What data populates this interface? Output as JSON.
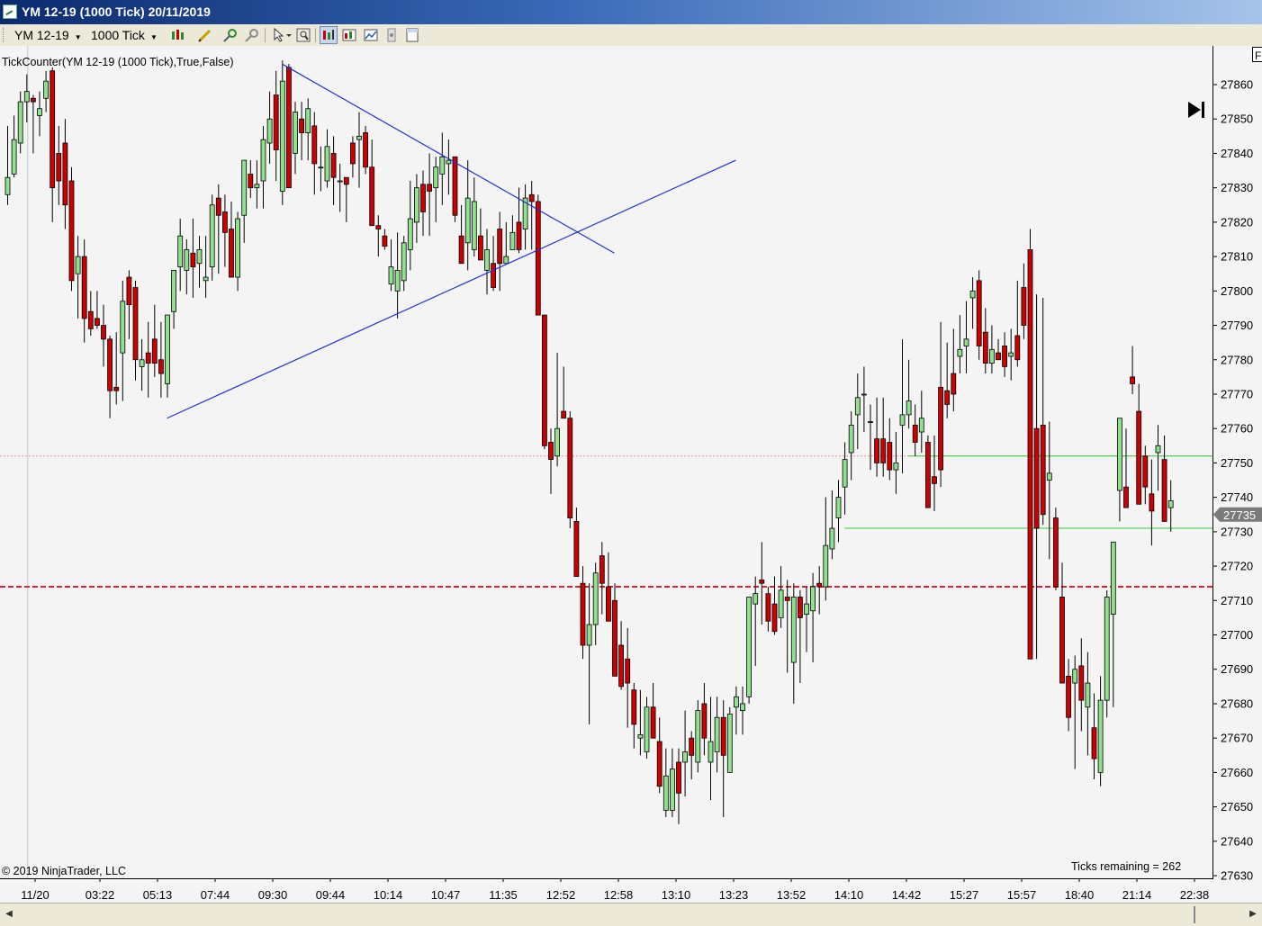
{
  "window": {
    "title": "YM 12-19 (1000 Tick)  20/11/2019",
    "icon": "chart-app-icon"
  },
  "toolbar": {
    "instrument": "YM 12-19",
    "interval": "1000 Tick",
    "icons": [
      "bar-style-icon",
      "pencil-draw-icon",
      "zoom-in-icon",
      "zoom-out-icon",
      "cursor-icon",
      "magnifier-icon",
      "data-series-icon",
      "indicators-icon",
      "strategies-icon",
      "properties-icon",
      "chart-trader-icon"
    ]
  },
  "chart": {
    "indicator_label": "TickCounter(YM 12-19 (1000 Tick),True,False)",
    "copyright": "© 2019 NinjaTrader, LLC",
    "ticks_remaining": "Ticks remaining = 262",
    "current_price_label": "27735",
    "corner_label": "F",
    "colors": {
      "up": "#90e090",
      "down": "#cc0000",
      "trendline": "#2233cc",
      "hline_green": "#33cc33",
      "hline_red": "#dd2233",
      "hline_dotted": "#e89090"
    }
  },
  "chart_data": {
    "type": "candlestick",
    "y_axis": {
      "ticks": [
        "27860",
        "27850",
        "27840",
        "27830",
        "27820",
        "27810",
        "27800",
        "27790",
        "27780",
        "27770",
        "27760",
        "27750",
        "27740",
        "27730",
        "27720",
        "27710",
        "27700",
        "27690",
        "27680",
        "27670",
        "27660",
        "27650",
        "27640",
        "27630"
      ],
      "range": [
        27628,
        27866
      ]
    },
    "x_axis": {
      "ticks": [
        "11/20",
        "03:22",
        "05:13",
        "07:44",
        "09:30",
        "09:44",
        "10:14",
        "10:47",
        "11:35",
        "12:52",
        "12:58",
        "13:10",
        "13:23",
        "13:52",
        "14:10",
        "14:42",
        "15:27",
        "15:57",
        "18:40",
        "21:14",
        "22:38"
      ]
    },
    "candles": [
      [
        27828,
        27848,
        27825,
        27833
      ],
      [
        27834,
        27851,
        27833,
        27844
      ],
      [
        27843,
        27858,
        27840,
        27855
      ],
      [
        27855,
        27863,
        27849,
        27858
      ],
      [
        27856,
        27857,
        27840,
        27855
      ],
      [
        27851,
        27858,
        27845,
        27853
      ],
      [
        27856,
        27864,
        27852,
        27861
      ],
      [
        27864,
        27865,
        27820,
        27830
      ],
      [
        27840,
        27848,
        27825,
        27832
      ],
      [
        27843,
        27850,
        27818,
        27825
      ],
      [
        27832,
        27836,
        27800,
        27803
      ],
      [
        27805,
        27816,
        27792,
        27810
      ],
      [
        27810,
        27815,
        27785,
        27792
      ],
      [
        27794,
        27800,
        27787,
        27789
      ],
      [
        27792,
        27800,
        27789,
        27790
      ],
      [
        27790,
        27796,
        27778,
        27786
      ],
      [
        27786,
        27787,
        27763,
        27771
      ],
      [
        27772,
        27788,
        27767,
        27771
      ],
      [
        27782,
        27803,
        27768,
        27797
      ],
      [
        27804,
        27806,
        27786,
        27796
      ],
      [
        27801,
        27803,
        27774,
        27780
      ],
      [
        27778,
        27786,
        27771,
        27780
      ],
      [
        27782,
        27791,
        27769,
        27779
      ],
      [
        27786,
        27796,
        27775,
        27779
      ],
      [
        27780,
        27791,
        27769,
        27776
      ],
      [
        27773,
        27791,
        27769,
        27793
      ],
      [
        27794,
        27805,
        27789,
        27806
      ],
      [
        27807,
        27821,
        27800,
        27816
      ],
      [
        27806,
        27815,
        27799,
        27812
      ],
      [
        27811,
        27821,
        27798,
        27807
      ],
      [
        27808,
        27816,
        27801,
        27812
      ],
      [
        27803,
        27816,
        27798,
        27804
      ],
      [
        27807,
        27828,
        27803,
        27825
      ],
      [
        27827,
        27831,
        27805,
        27822
      ],
      [
        27823,
        27828,
        27807,
        27817
      ],
      [
        27818,
        27826,
        27806,
        27804
      ],
      [
        27804,
        27823,
        27800,
        27821
      ],
      [
        27822,
        27837,
        27814,
        27838
      ],
      [
        27834,
        27838,
        27827,
        27830
      ],
      [
        27830,
        27838,
        27824,
        27831
      ],
      [
        27832,
        27848,
        27824,
        27844
      ],
      [
        27843,
        27858,
        27837,
        27850
      ],
      [
        27857,
        27864,
        27832,
        27841
      ],
      [
        27829,
        27867,
        27825,
        27861
      ],
      [
        27865,
        27866,
        27840,
        27830
      ],
      [
        27840,
        27855,
        27834,
        27852
      ],
      [
        27850,
        27855,
        27838,
        27846
      ],
      [
        27846,
        27856,
        27838,
        27853
      ],
      [
        27848,
        27852,
        27828,
        27837
      ],
      [
        27836,
        27842,
        27829,
        27836
      ],
      [
        27832,
        27847,
        27830,
        27842
      ],
      [
        27840,
        27845,
        27825,
        27833
      ],
      [
        27832,
        27837,
        27823,
        27832
      ],
      [
        27833,
        27832,
        27820,
        27831
      ],
      [
        27843,
        27845,
        27833,
        27837
      ],
      [
        27844,
        27852,
        27830,
        27845
      ],
      [
        27846,
        27848,
        27834,
        27836
      ],
      [
        27836,
        27844,
        27826,
        27819
      ],
      [
        27819,
        27822,
        27810,
        27818
      ],
      [
        27816,
        27818,
        27812,
        27813
      ],
      [
        27802,
        27815,
        27800,
        27807
      ],
      [
        27800,
        27817,
        27792,
        27806
      ],
      [
        27803,
        27816,
        27800,
        27814
      ],
      [
        27812,
        27832,
        27806,
        27821
      ],
      [
        27820,
        27834,
        27814,
        27830
      ],
      [
        27831,
        27835,
        27816,
        27823
      ],
      [
        27831,
        27840,
        27816,
        27829
      ],
      [
        27830,
        27839,
        27820,
        27836
      ],
      [
        27834,
        27846,
        27825,
        27839
      ],
      [
        27837,
        27844,
        27828,
        27838
      ],
      [
        27839,
        27839,
        27820,
        27822
      ],
      [
        27816,
        27825,
        27808,
        27808
      ],
      [
        27814,
        27838,
        27806,
        27827
      ],
      [
        27812,
        27833,
        27810,
        27826
      ],
      [
        27816,
        27824,
        27809,
        27809
      ],
      [
        27806,
        27818,
        27799,
        27812
      ],
      [
        27808,
        27816,
        27800,
        27801
      ],
      [
        27818,
        27823,
        27800,
        27808
      ],
      [
        27808,
        27820,
        27809,
        27810
      ],
      [
        27812,
        27822,
        27812,
        27817
      ],
      [
        27820,
        27830,
        27811,
        27812
      ],
      [
        27818,
        27831,
        27812,
        27827
      ],
      [
        27828,
        27832,
        27812,
        27826
      ],
      [
        27826,
        27828,
        27796,
        27793
      ],
      [
        27793,
        27791,
        27754,
        27755
      ],
      [
        27756,
        27760,
        27741,
        27751
      ],
      [
        27752,
        27782,
        27749,
        27760
      ],
      [
        27765,
        27778,
        27763,
        27763
      ],
      [
        27763,
        27765,
        27731,
        27734
      ],
      [
        27733,
        27737,
        27719,
        27717
      ],
      [
        27715,
        27720,
        27693,
        27697
      ],
      [
        27697,
        27715,
        27674,
        27703
      ],
      [
        27703,
        27721,
        27697,
        27718
      ],
      [
        27723,
        27727,
        27706,
        27715
      ],
      [
        27714,
        27724,
        27709,
        27704
      ],
      [
        27710,
        27715,
        27690,
        27688
      ],
      [
        27697,
        27704,
        27684,
        27685
      ],
      [
        27693,
        27702,
        27673,
        27686
      ],
      [
        27684,
        27686,
        27667,
        27674
      ],
      [
        27670,
        27684,
        27665,
        27671
      ],
      [
        27666,
        27682,
        27664,
        27679
      ],
      [
        27679,
        27686,
        27670,
        27670
      ],
      [
        27669,
        27676,
        27654,
        27656
      ],
      [
        27649,
        27667,
        27647,
        27659
      ],
      [
        27649,
        27667,
        27647,
        27661
      ],
      [
        27663,
        27667,
        27645,
        27654
      ],
      [
        27663,
        27678,
        27653,
        27666
      ],
      [
        27670,
        27672,
        27658,
        27665
      ],
      [
        27663,
        27681,
        27660,
        27678
      ],
      [
        27680,
        27686,
        27665,
        27670
      ],
      [
        27663,
        27682,
        27652,
        27669
      ],
      [
        27666,
        27682,
        27660,
        27676
      ],
      [
        27676,
        27681,
        27647,
        27665
      ],
      [
        27660,
        27679,
        27660,
        27677
      ],
      [
        27679,
        27685,
        27671,
        27682
      ],
      [
        27678,
        27685,
        27671,
        27680
      ],
      [
        27682,
        27710,
        27680,
        27711
      ],
      [
        27709,
        27717,
        27691,
        27712
      ],
      [
        27716,
        27727,
        27703,
        27715
      ],
      [
        27712,
        27714,
        27701,
        27704
      ],
      [
        27709,
        27717,
        27700,
        27701
      ],
      [
        27705,
        27720,
        27702,
        27713
      ],
      [
        27711,
        27716,
        27689,
        27710
      ],
      [
        27692,
        27715,
        27680,
        27711
      ],
      [
        27711,
        27713,
        27686,
        27705
      ],
      [
        27706,
        27714,
        27695,
        27709
      ],
      [
        27707,
        27718,
        27692,
        27714
      ],
      [
        27715,
        27720,
        27706,
        27714
      ],
      [
        27714,
        27740,
        27710,
        27726
      ],
      [
        27725,
        27742,
        27722,
        27731
      ],
      [
        27734,
        27745,
        27727,
        27740
      ],
      [
        27743,
        27756,
        27735,
        27751
      ],
      [
        27753,
        27765,
        27745,
        27761
      ],
      [
        27764,
        27776,
        27754,
        27769
      ],
      [
        27770,
        27778,
        27759,
        27770
      ],
      [
        27762,
        27767,
        27748,
        27762
      ],
      [
        27757,
        27769,
        27746,
        27750
      ],
      [
        27757,
        27769,
        27746,
        27750
      ],
      [
        27756,
        27763,
        27745,
        27748
      ],
      [
        27748,
        27759,
        27741,
        27750
      ],
      [
        27761,
        27786,
        27747,
        27764
      ],
      [
        27764,
        27780,
        27760,
        27768
      ],
      [
        27761,
        27767,
        27752,
        27756
      ],
      [
        27759,
        27771,
        27753,
        27763
      ],
      [
        27756,
        27758,
        27739,
        27737
      ],
      [
        27746,
        27758,
        27736,
        27744
      ],
      [
        27772,
        27791,
        27743,
        27748
      ],
      [
        27771,
        27785,
        27763,
        27767
      ],
      [
        27776,
        27789,
        27765,
        27770
      ],
      [
        27781,
        27793,
        27776,
        27783
      ],
      [
        27784,
        27797,
        27776,
        27786
      ],
      [
        27798,
        27804,
        27789,
        27800
      ],
      [
        27803,
        27806,
        27780,
        27784
      ],
      [
        27788,
        27795,
        27776,
        27779
      ],
      [
        27779,
        27790,
        27776,
        27783
      ],
      [
        27782,
        27786,
        27780,
        27780
      ],
      [
        27784,
        27788,
        27775,
        27778
      ],
      [
        27781,
        27789,
        27774,
        27782
      ],
      [
        27787,
        27803,
        27778,
        27780
      ],
      [
        27801,
        27808,
        27786,
        27790
      ],
      [
        27812,
        27818,
        27696,
        27693
      ],
      [
        27760,
        27799,
        27693,
        27731
      ],
      [
        27761,
        27798,
        27732,
        27735
      ],
      [
        27745,
        27762,
        27722,
        27747
      ],
      [
        27734,
        27737,
        27713,
        27714
      ],
      [
        27711,
        27721,
        27699,
        27686
      ],
      [
        27688,
        27693,
        27672,
        27676
      ],
      [
        27686,
        27694,
        27661,
        27690
      ],
      [
        27691,
        27699,
        27672,
        27681
      ],
      [
        27679,
        27695,
        27665,
        27686
      ],
      [
        27673,
        27683,
        27658,
        27664
      ],
      [
        27660,
        27688,
        27656,
        27681
      ],
      [
        27681,
        27713,
        27676,
        27711
      ],
      [
        27706,
        27713,
        27679,
        27727
      ],
      [
        27742,
        27763,
        27733,
        27763
      ],
      [
        27743,
        27760,
        27738,
        27737
      ],
      [
        27775,
        27784,
        27770,
        27773
      ],
      [
        27765,
        27773,
        27750,
        27738
      ],
      [
        27752,
        27755,
        27738,
        27743
      ],
      [
        27741,
        27751,
        27726,
        27736
      ],
      [
        27753,
        27761,
        27742,
        27755
      ],
      [
        27751,
        27758,
        27733,
        27733
      ],
      [
        27737,
        27745,
        27730,
        27739
      ]
    ],
    "annotations": {
      "trendlines": [
        {
          "from": [
            43,
            27866
          ],
          "to": [
            95,
            27811
          ]
        },
        {
          "from": [
            25,
            27763
          ],
          "to": [
            114,
            27838
          ]
        }
      ],
      "horizontal_lines": [
        {
          "price": 27752,
          "style": "dotted",
          "color": "#e89090",
          "full_width": true
        },
        {
          "price": 27714,
          "style": "dashed",
          "color": "#dd2233",
          "full_width": true
        },
        {
          "price": 27752,
          "style": "solid",
          "color": "#33cc33",
          "from_bar": 141
        },
        {
          "price": 27731,
          "style": "solid",
          "color": "#33cc33",
          "from_bar": 131
        }
      ],
      "vertical_line_bar": 3
    }
  }
}
